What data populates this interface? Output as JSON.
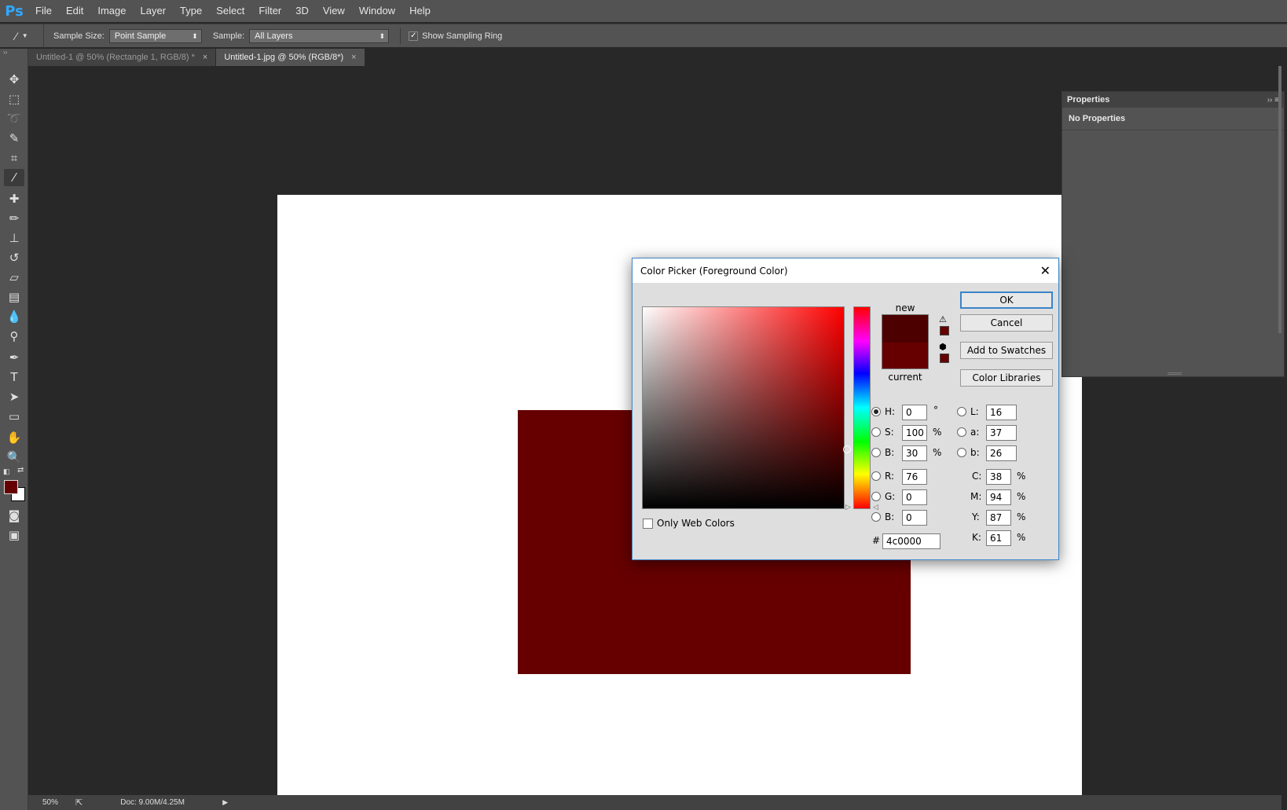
{
  "app": {
    "logo": "Ps"
  },
  "menu": [
    "File",
    "Edit",
    "Image",
    "Layer",
    "Type",
    "Select",
    "Filter",
    "3D",
    "View",
    "Window",
    "Help"
  ],
  "options": {
    "tool_icon": "eyedropper-icon",
    "sample_size_label": "Sample Size:",
    "sample_size_value": "Point Sample",
    "sample_label": "Sample:",
    "sample_value": "All Layers",
    "show_ring_label": "Show Sampling Ring",
    "show_ring_checked": true
  },
  "tabs": [
    {
      "title": "Untitled-1 @ 50% (Rectangle 1, RGB/8) *",
      "close": "×",
      "active": false
    },
    {
      "title": "Untitled-1.jpg @ 50% (RGB/8*)",
      "close": "×",
      "active": true
    }
  ],
  "tools": [
    "move-icon",
    "marquee-icon",
    "lasso-icon",
    "quick-select-icon",
    "crop-icon",
    "eyedropper-icon",
    "healing-icon",
    "brush-icon",
    "stamp-icon",
    "history-brush-icon",
    "eraser-icon",
    "gradient-icon",
    "blur-icon",
    "dodge-icon",
    "pen-icon",
    "type-icon",
    "path-select-icon",
    "rectangle-icon",
    "hand-icon",
    "zoom-icon"
  ],
  "colors": {
    "foreground": "#660000",
    "background": "#ffffff",
    "canvas_rect": "#660000",
    "picker_new": "#4c0000"
  },
  "properties": {
    "title": "Properties",
    "body_title": "No Properties"
  },
  "status": {
    "zoom": "50%",
    "doc": "Doc: 9.00M/4.25M"
  },
  "dialog": {
    "title": "Color Picker (Foreground Color)",
    "new_label": "new",
    "current_label": "current",
    "buttons": {
      "ok": "OK",
      "cancel": "Cancel",
      "add_swatches": "Add to Swatches",
      "color_libraries": "Color Libraries"
    },
    "only_web_colors": "Only Web Colors",
    "hsb": {
      "h_label": "H:",
      "h": "0",
      "h_unit": "°",
      "s_label": "S:",
      "s": "100",
      "s_unit": "%",
      "b_label": "B:",
      "b": "30",
      "b_unit": "%"
    },
    "rgb": {
      "r_label": "R:",
      "r": "76",
      "g_label": "G:",
      "g": "0",
      "b_label": "B:",
      "b": "0"
    },
    "lab": {
      "l_label": "L:",
      "l": "16",
      "a_label": "a:",
      "a": "37",
      "b_label": "b:",
      "b": "26"
    },
    "cmyk": {
      "c_label": "C:",
      "c": "38",
      "m_label": "M:",
      "m": "94",
      "y_label": "Y:",
      "y": "87",
      "k_label": "K:",
      "k": "61",
      "unit": "%"
    },
    "hex_label": "#",
    "hex": "4c0000",
    "selected_channel": "H"
  }
}
